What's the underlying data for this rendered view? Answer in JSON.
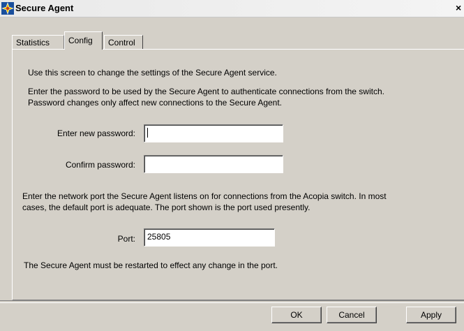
{
  "window": {
    "title": "Secure Agent",
    "close_glyph": "×"
  },
  "tabs": [
    {
      "label": "Statistics"
    },
    {
      "label": "Config"
    },
    {
      "label": "Control"
    }
  ],
  "config": {
    "intro": "Use this screen to change the settings of the Secure Agent service.",
    "password_help_1": "Enter the password to be used by the Secure Agent to authenticate connections from the switch.",
    "password_help_2": "Password changes only affect new connections to the Secure Agent.",
    "new_password_label": "Enter new password:",
    "new_password_value": "",
    "confirm_password_label": "Confirm password:",
    "confirm_password_value": "",
    "port_help_1": "Enter the network port the Secure Agent listens on for connections from the Acopia switch.  In most",
    "port_help_2": "cases, the default port is adequate.  The port shown is the port used presently.",
    "port_label": "Port:",
    "port_value": "25805",
    "restart_note": "The Secure Agent must be restarted to effect any change in the port."
  },
  "buttons": {
    "ok": "OK",
    "cancel": "Cancel",
    "apply": "Apply"
  },
  "icons": {
    "app": "secure-agent-app-icon",
    "close": "close-icon"
  }
}
